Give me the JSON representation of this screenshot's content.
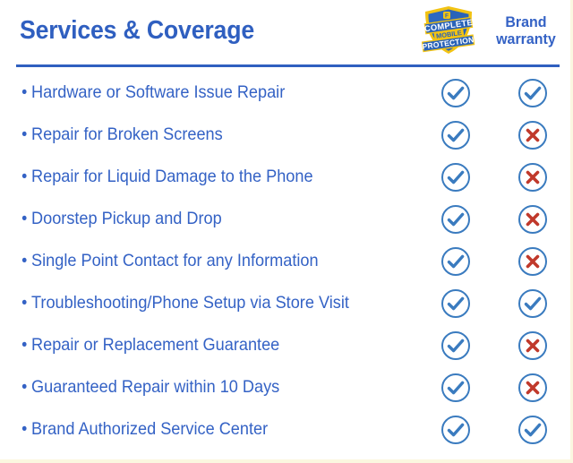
{
  "header": {
    "title": "Services & Coverage",
    "columns": [
      {
        "id": "cmp",
        "type": "logo",
        "logo_name": "complete-mobile-protection-logo",
        "logo_text": {
          "line1": "COMPLETE",
          "line2": "MOBILE",
          "line3": "PROTECTION"
        }
      },
      {
        "id": "brand",
        "type": "text",
        "label_line1": "Brand",
        "label_line2": "warranty"
      }
    ]
  },
  "colors": {
    "primary_blue": "#3462c5",
    "title_blue": "#2f5fc0",
    "check_blue": "#3a7bbf",
    "circle_blue": "#3a7bbf",
    "cross_red": "#c0392b",
    "logo_yellow": "#f2c313",
    "logo_blue": "#1b56a8",
    "edge_cream": "#fbf7e0"
  },
  "rows": [
    {
      "label": "Hardware or Software Issue Repair",
      "cmp": "check",
      "brand": "check"
    },
    {
      "label": "Repair for Broken Screens",
      "cmp": "check",
      "brand": "cross"
    },
    {
      "label": "Repair for Liquid Damage to the Phone",
      "cmp": "check",
      "brand": "cross"
    },
    {
      "label": "Doorstep Pickup and Drop",
      "cmp": "check",
      "brand": "cross"
    },
    {
      "label": "Single Point Contact for any Information",
      "cmp": "check",
      "brand": "cross"
    },
    {
      "label": "Troubleshooting/Phone Setup via Store Visit",
      "cmp": "check",
      "brand": "check"
    },
    {
      "label": "Repair or Replacement Guarantee",
      "cmp": "check",
      "brand": "cross"
    },
    {
      "label": "Guaranteed Repair within 10 Days",
      "cmp": "check",
      "brand": "cross"
    },
    {
      "label": "Brand Authorized Service Center",
      "cmp": "check",
      "brand": "check"
    }
  ],
  "icons": {
    "check": "check-circle-icon",
    "cross": "cross-circle-icon",
    "bullet": "bullet-dot"
  }
}
